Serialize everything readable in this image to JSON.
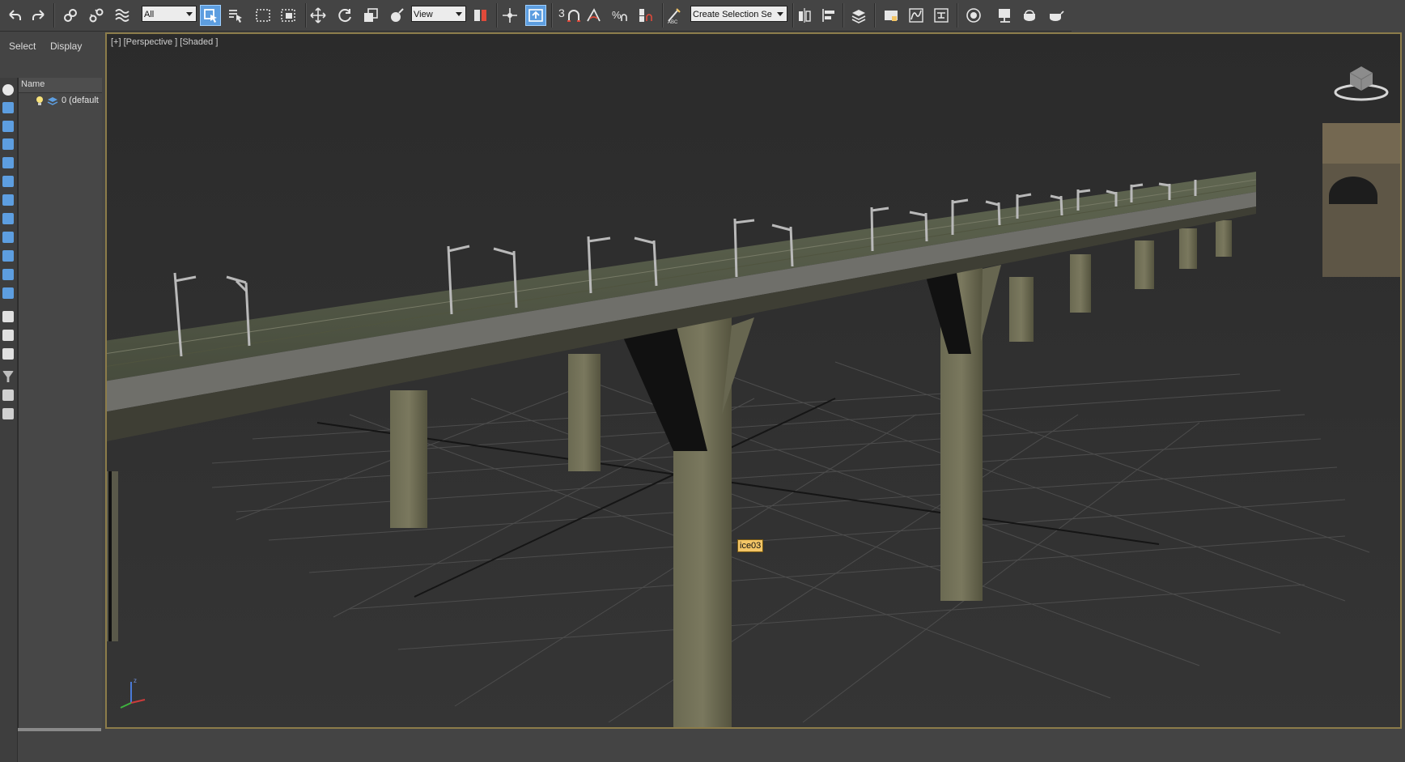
{
  "toolbar": {
    "selection_filter": "All",
    "reference_coord": "View",
    "snap_angle_label": "3",
    "named_selection_placeholder": "Create Selection Se",
    "icons": [
      "undo-icon",
      "redo-icon",
      "link-icon",
      "unlink-icon",
      "bind-space-warp-icon",
      "select-object-icon",
      "select-by-name-icon",
      "rectangular-selection-icon",
      "window-crossing-icon",
      "move-icon",
      "rotate-icon",
      "scale-icon",
      "place-icon",
      "select-manipulate-icon",
      "keyboard-shortcut-icon",
      "snaps-toggle-icon",
      "angle-snap-icon",
      "percent-snap-icon",
      "spinner-snap-icon",
      "edit-named-selection-icon",
      "mirror-icon",
      "align-icon",
      "layer-explorer-icon",
      "toggle-ribbon-icon",
      "curve-editor-icon",
      "schematic-view-icon",
      "material-editor-icon",
      "render-setup-icon",
      "rendered-frame-window-icon",
      "render-production-icon"
    ]
  },
  "left_panel": {
    "tabs": [
      "Select",
      "Display"
    ],
    "column_header": "Name",
    "layer_row": "0 (default"
  },
  "viewport": {
    "label": "[+] [Perspective ] [Shaded ]",
    "object_tag": "ice03"
  },
  "colors": {
    "active_tool": "#5d9ee0",
    "viewport_border": "#8c7c4a",
    "tag_background": "#f3c566"
  }
}
